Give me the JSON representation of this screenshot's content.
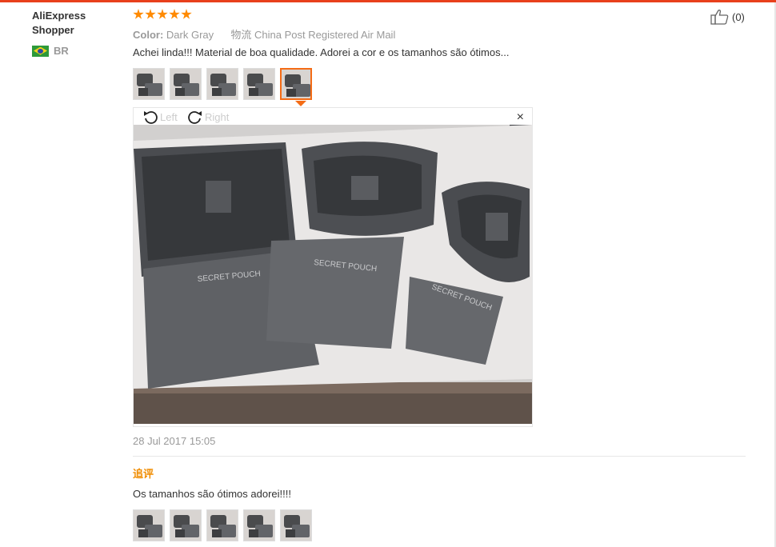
{
  "review": {
    "author_line1": "AliExpress",
    "author_line2": "Shopper",
    "country": "BR",
    "rating": 5,
    "color_label": "Color:",
    "color_value": "Dark Gray",
    "shipping_label": "物流",
    "shipping_value": "China Post Registered Air Mail",
    "text": "Achei linda!!! Material de boa qualidade. Adorei a cor e os tamanhos são ótimos...",
    "thumbnail_count": 5,
    "active_thumbnail": 4,
    "viewer": {
      "rotate_left_label": "Left",
      "rotate_right_label": "Right",
      "close_label": "×",
      "photo_print": [
        "SECRET POUCH",
        "SECRET POUCH",
        "SECRET POUCH"
      ]
    },
    "date": "28 Jul 2017 15:05",
    "helpful_count": "(0)"
  },
  "followup": {
    "label": "追评",
    "text": "Os tamanhos são ótimos adorei!!!!",
    "thumbnail_count": 5
  },
  "colors": {
    "accent": "#e8401c",
    "star": "#ff8a00",
    "active_border": "#f46c16",
    "followup_label": "#f08c00"
  },
  "icons": [
    "star-icon",
    "brazil-flag-icon",
    "rotate-left-icon",
    "rotate-right-icon",
    "close-icon",
    "thumbs-up-icon"
  ]
}
